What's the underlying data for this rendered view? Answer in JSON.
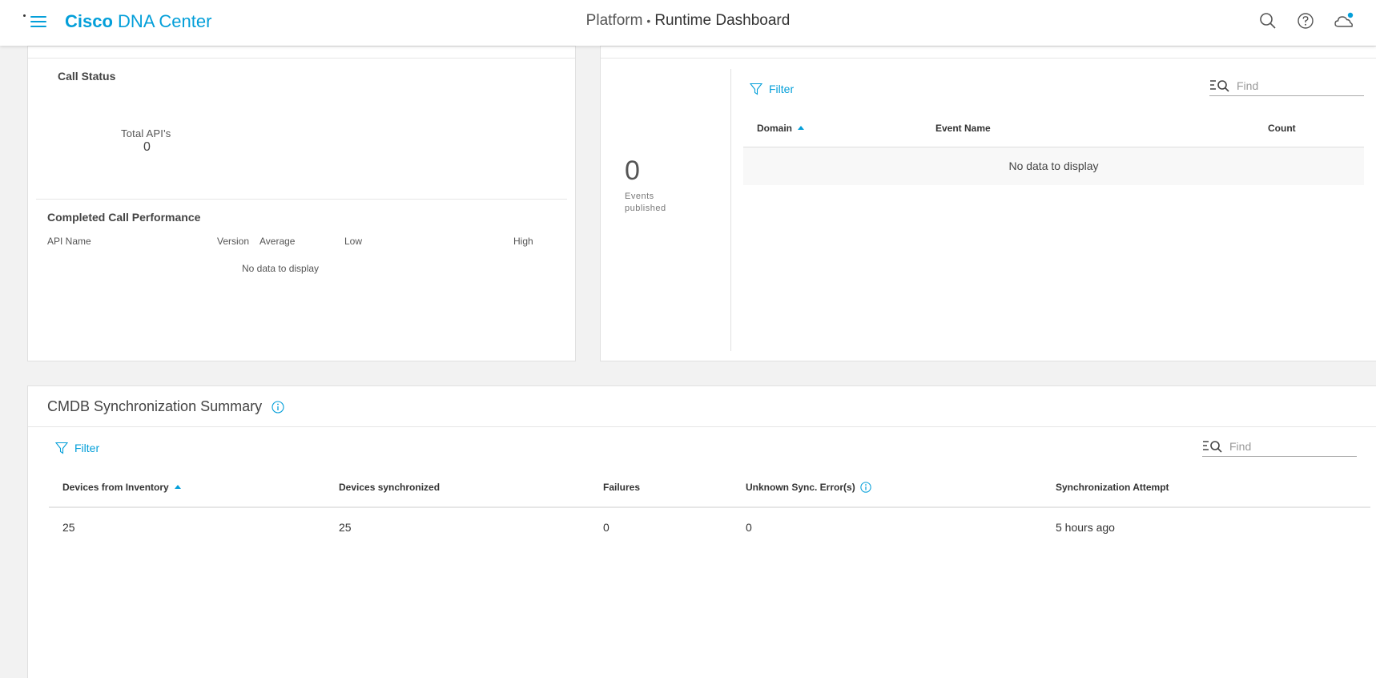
{
  "header": {
    "brand_bold": "Cisco",
    "brand_rest": "DNA Center",
    "section": "Platform",
    "separator": "•",
    "title": "Runtime Dashboard"
  },
  "call_status": {
    "title": "Call Status",
    "total_label": "Total API's",
    "total_value": "0"
  },
  "performance": {
    "title": "Completed Call Performance",
    "columns": [
      "API Name",
      "Version",
      "Average",
      "Low",
      "High"
    ],
    "empty": "No data to display"
  },
  "events": {
    "count": "0",
    "label_line1": "Events",
    "label_line2": "published",
    "filter_label": "Filter",
    "find_placeholder": "Find",
    "columns": [
      "Domain",
      "Event Name",
      "Count"
    ],
    "empty": "No data to display"
  },
  "cmdb": {
    "title": "CMDB Synchronization Summary",
    "filter_label": "Filter",
    "find_placeholder": "Find",
    "columns": [
      "Devices from Inventory",
      "Devices synchronized",
      "Failures",
      "Unknown Sync. Error(s)",
      "Synchronization Attempt"
    ],
    "rows": [
      [
        "25",
        "25",
        "0",
        "0",
        "5 hours ago"
      ]
    ]
  },
  "colors": {
    "accent": "#049fd9",
    "background": "#f2f2f2",
    "card": "#ffffff"
  },
  "icons": [
    "menu-icon",
    "search-icon",
    "help-icon",
    "notification-cloud-icon",
    "filter-icon",
    "find-icon",
    "info-icon",
    "sort-ascending-icon"
  ]
}
